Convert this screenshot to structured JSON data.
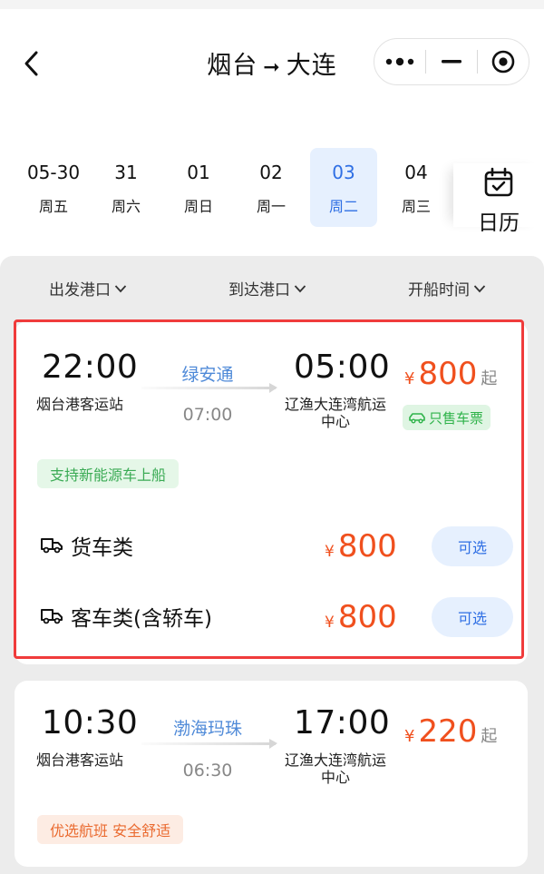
{
  "header": {
    "origin": "烟台",
    "destination": "大连",
    "arrow": "➞"
  },
  "dates": [
    {
      "date": "05-30",
      "weekday": "周五",
      "active": false
    },
    {
      "date": "31",
      "weekday": "周六",
      "active": false
    },
    {
      "date": "01",
      "weekday": "周日",
      "active": false
    },
    {
      "date": "02",
      "weekday": "周一",
      "active": false
    },
    {
      "date": "03",
      "weekday": "周二",
      "active": true
    },
    {
      "date": "04",
      "weekday": "周三",
      "active": false
    }
  ],
  "calendar_label": "日历",
  "filters": {
    "departure_port": "出发港口",
    "arrival_port": "到达港口",
    "sail_time": "开船时间"
  },
  "trips": [
    {
      "dep_time": "22:00",
      "dep_port": "烟台港客运站",
      "ship": "绿安通",
      "duration": "07:00",
      "arr_time": "05:00",
      "arr_port": "辽渔大连湾航运中心",
      "currency": "¥",
      "price": "800",
      "price_suffix": "起",
      "badge": "只售车票",
      "tag": "支持新能源车上船",
      "vehicles": [
        {
          "name": "货车类",
          "currency": "¥",
          "price": "800",
          "action": "可选"
        },
        {
          "name": "客车类(含轿车)",
          "currency": "¥",
          "price": "800",
          "action": "可选"
        }
      ]
    },
    {
      "dep_time": "10:30",
      "dep_port": "烟台港客运站",
      "ship": "渤海玛珠",
      "duration": "06:30",
      "arr_time": "17:00",
      "arr_port": "辽渔大连湾航运中心",
      "currency": "¥",
      "price": "220",
      "price_suffix": "起",
      "tag": "优选航班 安全舒适"
    }
  ],
  "colors": {
    "accent_blue": "#2f6fe4",
    "price_orange": "#f0501e",
    "badge_green": "#2fb34a",
    "highlight_red": "#f03b3b"
  }
}
